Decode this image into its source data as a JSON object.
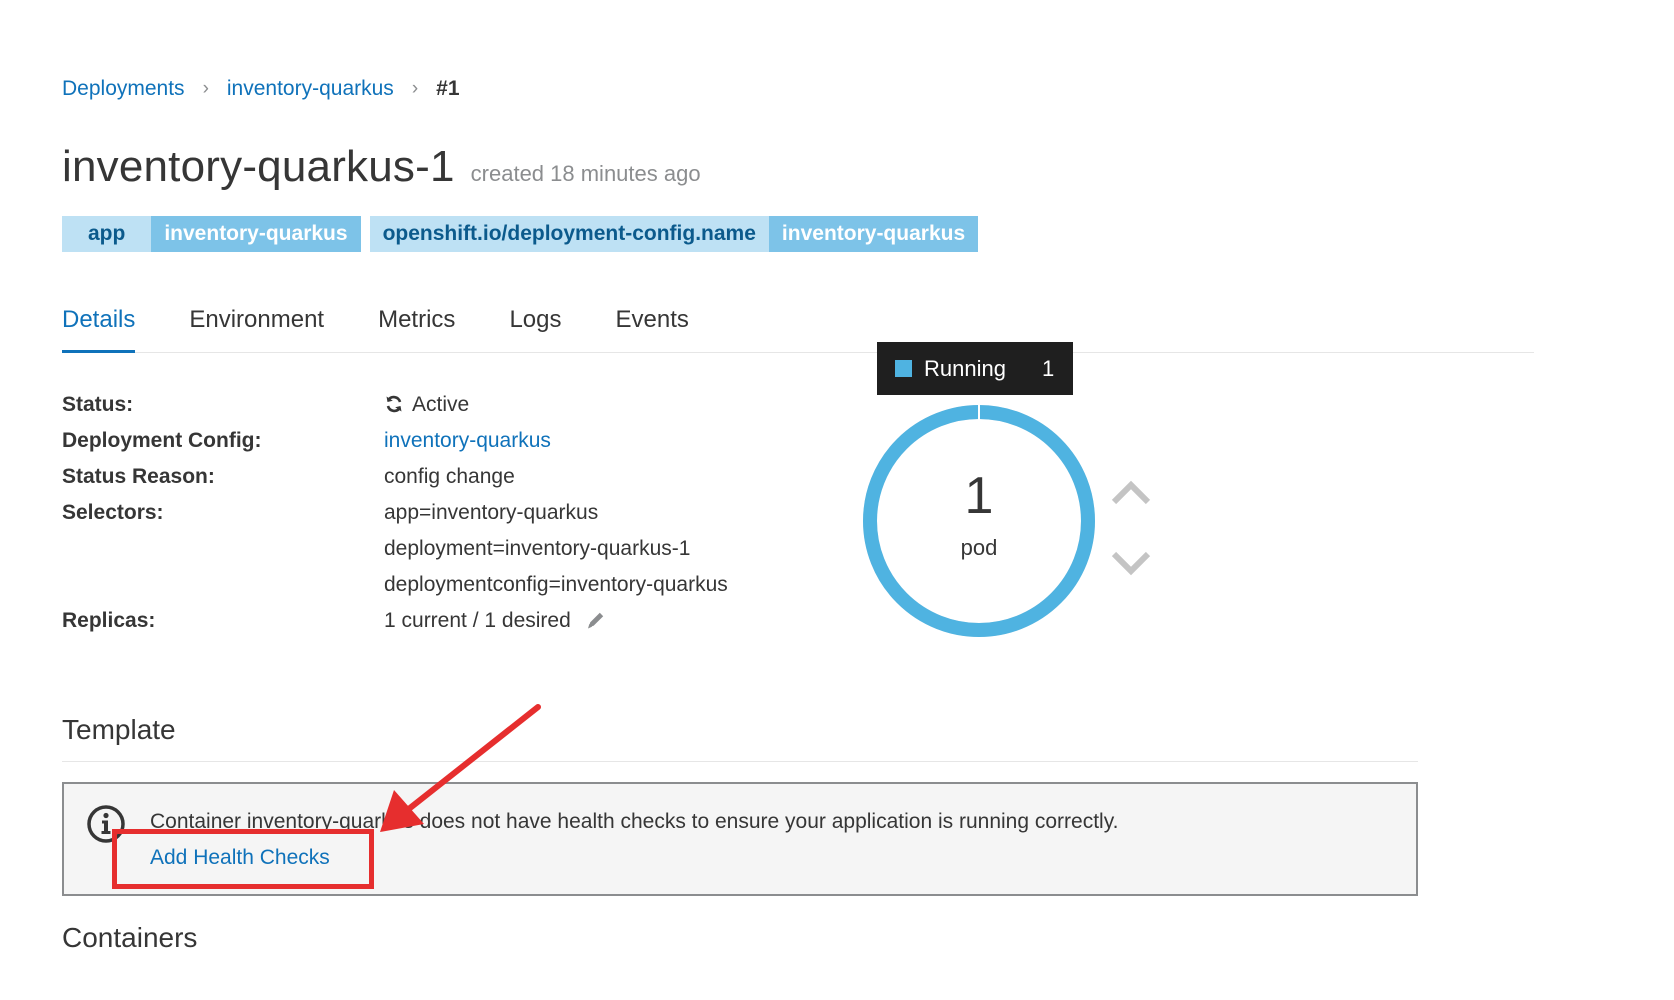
{
  "breadcrumb": {
    "items": [
      "Deployments",
      "inventory-quarkus"
    ],
    "current": "#1"
  },
  "header": {
    "title": "inventory-quarkus-1",
    "created": "created 18 minutes ago"
  },
  "labels": [
    {
      "key": "app",
      "value": "inventory-quarkus"
    },
    {
      "key": "openshift.io/deployment-config.name",
      "value": "inventory-quarkus"
    }
  ],
  "tabs": [
    {
      "label": "Details",
      "active": true
    },
    {
      "label": "Environment",
      "active": false
    },
    {
      "label": "Metrics",
      "active": false
    },
    {
      "label": "Logs",
      "active": false
    },
    {
      "label": "Events",
      "active": false
    }
  ],
  "details": {
    "status_label": "Status:",
    "status_value": "Active",
    "config_label": "Deployment Config:",
    "config_value": "inventory-quarkus",
    "reason_label": "Status Reason:",
    "reason_value": "config change",
    "selectors_label": "Selectors:",
    "selectors": [
      "app=inventory-quarkus",
      "deployment=inventory-quarkus-1",
      "deploymentconfig=inventory-quarkus"
    ],
    "replicas_label": "Replicas:",
    "replicas_value": "1 current / 1 desired"
  },
  "pods": {
    "tooltip_label": "Running",
    "tooltip_count": "1",
    "count": "1",
    "unit": "pod",
    "running_fraction": 1.0,
    "ring_color": "#4fb3e1"
  },
  "template": {
    "title": "Template",
    "alert_text": "Container inventory-quarkus does not have health checks to ensure your application is running correctly.",
    "alert_link": "Add Health Checks"
  },
  "containers": {
    "title": "Containers"
  },
  "icons": {
    "status": "refresh-icon",
    "edit": "pencil-icon",
    "info": "info-circle-icon",
    "scale_up": "chevron-up-icon",
    "scale_down": "chevron-down-icon"
  },
  "annotation_color": "#e62e2e"
}
